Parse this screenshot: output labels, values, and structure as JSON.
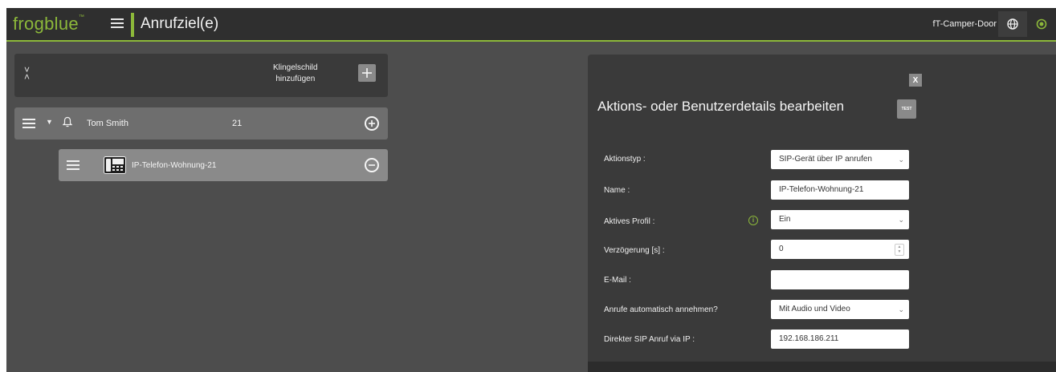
{
  "header": {
    "logo_text": "frogblue",
    "logo_tm": "™",
    "page_title": "Anrufziel(e)",
    "device_name": "fT-Camper-Door"
  },
  "left_panel": {
    "add_doorbell_label_line1": "Klingelschild",
    "add_doorbell_label_line2": "hinzufügen",
    "contact": {
      "name": "Tom Smith",
      "number": "21"
    },
    "device": {
      "label": "IP-Telefon-Wohnung-21"
    }
  },
  "dialog": {
    "close_label": "X",
    "title": "Aktions- oder Benutzerdetails bearbeiten",
    "test_label": "TEST",
    "fields": {
      "action_type": {
        "label": "Aktionstyp :",
        "value": "SIP-Gerät über IP anrufen"
      },
      "name": {
        "label": "Name :",
        "value": "IP-Telefon-Wohnung-21"
      },
      "active_profile": {
        "label": "Aktives Profil :",
        "value": "Ein"
      },
      "delay": {
        "label": "Verzögerung [s] :",
        "value": "0"
      },
      "email": {
        "label": "E-Mail :",
        "value": ""
      },
      "auto_answer": {
        "label": "Anrufe automatisch annehmen?",
        "value": "Mit Audio und Video"
      },
      "direct_sip": {
        "label": "Direkter SIP Anruf via IP :",
        "value": "192.168.186.211"
      }
    }
  },
  "colors": {
    "accent": "#8cb83a",
    "topbar": "#2f2f2f",
    "background": "#4d4d4d"
  }
}
